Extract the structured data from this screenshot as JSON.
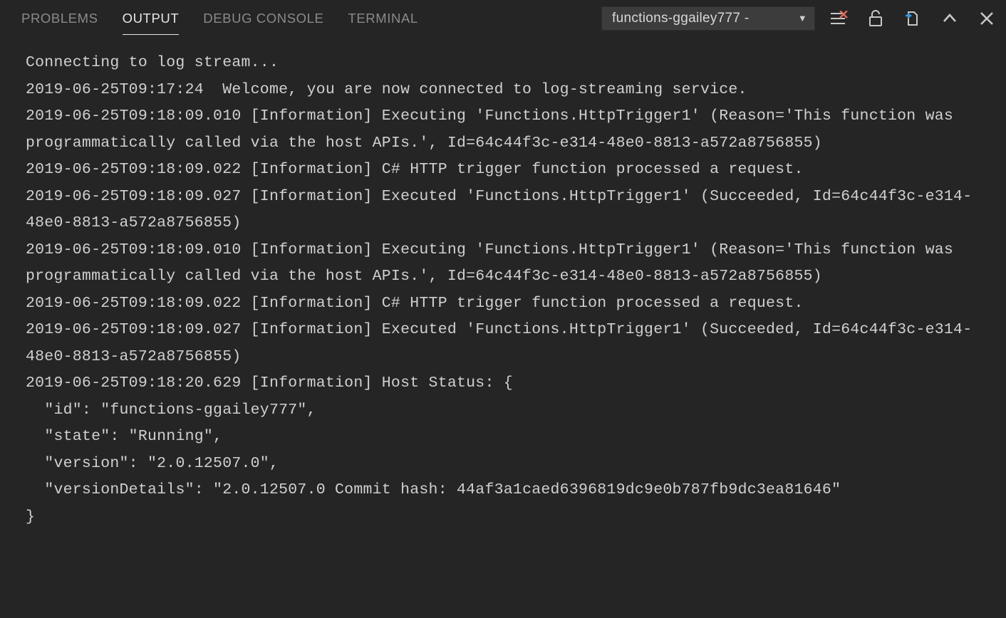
{
  "tabs": {
    "problems": "PROBLEMS",
    "output": "OUTPUT",
    "debug_console": "DEBUG CONSOLE",
    "terminal": "TERMINAL"
  },
  "dropdown": {
    "selected": "functions-ggailey777 -"
  },
  "log_lines": [
    "Connecting to log stream...",
    "2019-06-25T09:17:24  Welcome, you are now connected to log-streaming service.",
    "2019-06-25T09:18:09.010 [Information] Executing 'Functions.HttpTrigger1' (Reason='This function was programmatically called via the host APIs.', Id=64c44f3c-e314-48e0-8813-a572a8756855)",
    "2019-06-25T09:18:09.022 [Information] C# HTTP trigger function processed a request.",
    "2019-06-25T09:18:09.027 [Information] Executed 'Functions.HttpTrigger1' (Succeeded, Id=64c44f3c-e314-48e0-8813-a572a8756855)",
    "2019-06-25T09:18:09.010 [Information] Executing 'Functions.HttpTrigger1' (Reason='This function was programmatically called via the host APIs.', Id=64c44f3c-e314-48e0-8813-a572a8756855)",
    "2019-06-25T09:18:09.022 [Information] C# HTTP trigger function processed a request.",
    "2019-06-25T09:18:09.027 [Information] Executed 'Functions.HttpTrigger1' (Succeeded, Id=64c44f3c-e314-48e0-8813-a572a8756855)",
    "2019-06-25T09:18:20.629 [Information] Host Status: {",
    "  \"id\": \"functions-ggailey777\",",
    "  \"state\": \"Running\",",
    "  \"version\": \"2.0.12507.0\",",
    "  \"versionDetails\": \"2.0.12507.0 Commit hash: 44af3a1caed6396819dc9e0b787fb9dc3ea81646\"",
    "}"
  ]
}
